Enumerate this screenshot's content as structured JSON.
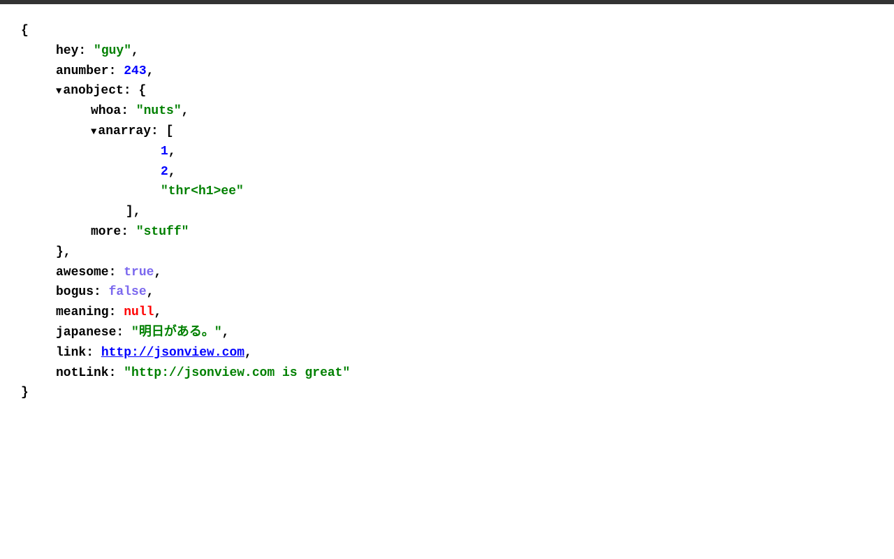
{
  "json": {
    "open_brace": "{",
    "close_brace": "}",
    "fields": [
      {
        "key": "hey",
        "type": "string",
        "value": "\"guy\"",
        "comma": ","
      },
      {
        "key": "anumber",
        "type": "number",
        "value": "243",
        "comma": ","
      },
      {
        "key": "anobject",
        "type": "object",
        "collapsed": false,
        "open": "{",
        "comma_after_close": ",",
        "children": [
          {
            "key": "whoa",
            "type": "string",
            "value": "\"nuts\"",
            "comma": ","
          },
          {
            "key": "anarray",
            "type": "array",
            "collapsed": false,
            "open": "[",
            "comma_after_close": "",
            "items": [
              {
                "type": "number",
                "value": "1",
                "comma": ","
              },
              {
                "type": "number",
                "value": "2",
                "comma": ","
              },
              {
                "type": "string",
                "value": "\"thr<h1>ee\"",
                "comma": ""
              }
            ]
          },
          {
            "key": "more",
            "type": "string",
            "value": "\"stuff\"",
            "comma": ""
          }
        ]
      },
      {
        "key": "awesome",
        "type": "boolean_true",
        "value": "true",
        "comma": ","
      },
      {
        "key": "bogus",
        "type": "boolean_false",
        "value": "false",
        "comma": ","
      },
      {
        "key": "meaning",
        "type": "null",
        "value": "null",
        "comma": ","
      },
      {
        "key": "japanese",
        "type": "string",
        "value": "\"明日がある。\"",
        "comma": ","
      },
      {
        "key": "link",
        "type": "link",
        "value": "http://jsonview.com",
        "comma": ","
      },
      {
        "key": "notLink",
        "type": "string",
        "value": "\"http://jsonview.com is great\"",
        "comma": ""
      }
    ]
  }
}
